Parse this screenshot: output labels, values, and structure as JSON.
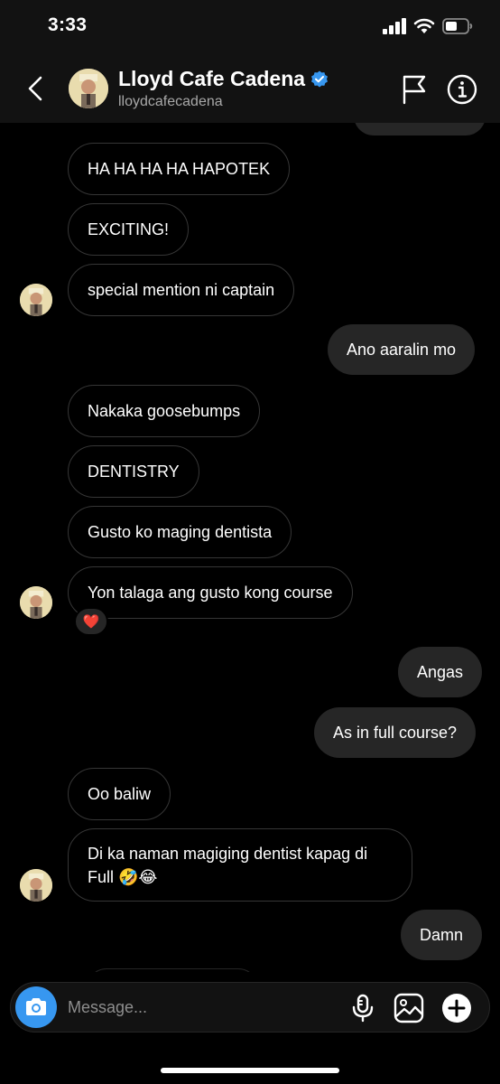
{
  "status_bar": {
    "time": "3:33"
  },
  "header": {
    "name": "Lloyd Cafe Cadena",
    "handle": "lloydcafecadena"
  },
  "messages": [
    {
      "side": "received",
      "text": "HA HA HA HA HAPOTEK"
    },
    {
      "side": "received",
      "text": "EXCITING!"
    },
    {
      "side": "received",
      "text": "special mention ni captain"
    },
    {
      "side": "sent",
      "text": "Ano aaralin mo"
    },
    {
      "side": "received",
      "text": "Nakaka goosebumps"
    },
    {
      "side": "received",
      "text": "DENTISTRY"
    },
    {
      "side": "received",
      "text": "Gusto ko maging dentista"
    },
    {
      "side": "received",
      "text": "Yon talaga ang gusto kong course",
      "reaction": "❤️"
    },
    {
      "side": "sent",
      "text": "Angas"
    },
    {
      "side": "sent",
      "text": "As in full course?"
    },
    {
      "side": "received",
      "text": "Oo baliw"
    },
    {
      "side": "received",
      "text": "Di ka naman magiging dentist kapag di",
      "text_line2": "Full 🤣😂"
    },
    {
      "side": "sent",
      "text": "Damn"
    }
  ],
  "composer": {
    "placeholder": "Message..."
  },
  "colors": {
    "accent": "#3797f0",
    "sent_bubble": "#262626",
    "background": "#000000",
    "verified": "#3797f0"
  }
}
